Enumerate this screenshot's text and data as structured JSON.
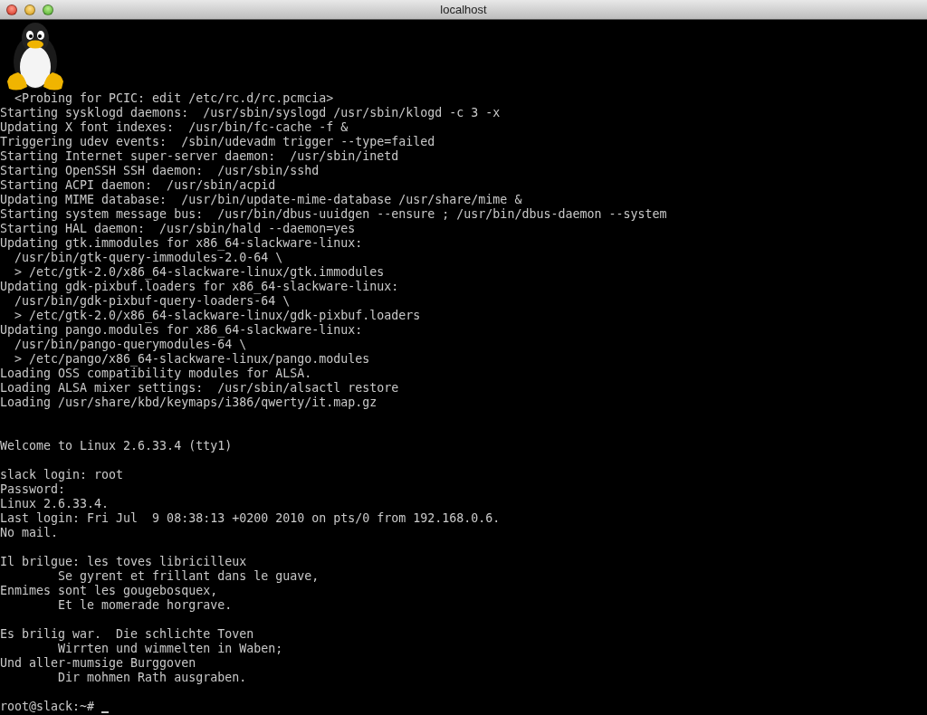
{
  "window": {
    "title": "localhost"
  },
  "terminal": {
    "lines": [
      {
        "kind": "text",
        "text": "  <Probing for PCIC: edit /etc/rc.d/rc.pcmcia>"
      },
      {
        "kind": "text",
        "text": "Starting sysklogd daemons:  /usr/sbin/syslogd /usr/sbin/klogd -c 3 -x"
      },
      {
        "kind": "text",
        "text": "Updating X font indexes:  /usr/bin/fc-cache -f &"
      },
      {
        "kind": "text",
        "text": "Triggering udev events:  /sbin/udevadm trigger --type=failed"
      },
      {
        "kind": "text",
        "text": "Starting Internet super-server daemon:  /usr/sbin/inetd"
      },
      {
        "kind": "text",
        "text": "Starting OpenSSH SSH daemon:  /usr/sbin/sshd"
      },
      {
        "kind": "text",
        "text": "Starting ACPI daemon:  /usr/sbin/acpid"
      },
      {
        "kind": "text",
        "text": "Updating MIME database:  /usr/bin/update-mime-database /usr/share/mime &"
      },
      {
        "kind": "text",
        "text": "Starting system message bus:  /usr/bin/dbus-uuidgen --ensure ; /usr/bin/dbus-daemon --system"
      },
      {
        "kind": "text",
        "text": "Starting HAL daemon:  /usr/sbin/hald --daemon=yes"
      },
      {
        "kind": "text",
        "text": "Updating gtk.immodules for x86_64-slackware-linux:"
      },
      {
        "kind": "text",
        "text": "  /usr/bin/gtk-query-immodules-2.0-64 \\"
      },
      {
        "kind": "text",
        "text": "  > /etc/gtk-2.0/x86_64-slackware-linux/gtk.immodules"
      },
      {
        "kind": "text",
        "text": "Updating gdk-pixbuf.loaders for x86_64-slackware-linux:"
      },
      {
        "kind": "text",
        "text": "  /usr/bin/gdk-pixbuf-query-loaders-64 \\"
      },
      {
        "kind": "text",
        "text": "  > /etc/gtk-2.0/x86_64-slackware-linux/gdk-pixbuf.loaders"
      },
      {
        "kind": "text",
        "text": "Updating pango.modules for x86_64-slackware-linux:"
      },
      {
        "kind": "text",
        "text": "  /usr/bin/pango-querymodules-64 \\"
      },
      {
        "kind": "text",
        "text": "  > /etc/pango/x86_64-slackware-linux/pango.modules"
      },
      {
        "kind": "text",
        "text": "Loading OSS compatibility modules for ALSA."
      },
      {
        "kind": "text",
        "text": "Loading ALSA mixer settings:  /usr/sbin/alsactl restore"
      },
      {
        "kind": "text",
        "text": "Loading /usr/share/kbd/keymaps/i386/qwerty/it.map.gz"
      },
      {
        "kind": "blank"
      },
      {
        "kind": "blank"
      },
      {
        "kind": "text",
        "text": "Welcome to Linux 2.6.33.4 (tty1)"
      },
      {
        "kind": "blank"
      },
      {
        "kind": "text",
        "text": "slack login: root"
      },
      {
        "kind": "text",
        "text": "Password:"
      },
      {
        "kind": "text",
        "text": "Linux 2.6.33.4."
      },
      {
        "kind": "text",
        "text": "Last login: Fri Jul  9 08:38:13 +0200 2010 on pts/0 from 192.168.0.6."
      },
      {
        "kind": "text",
        "text": "No mail."
      },
      {
        "kind": "blank"
      },
      {
        "kind": "text",
        "text": "Il brilgue: les toves libricilleux"
      },
      {
        "kind": "text",
        "text": "        Se gyrent et frillant dans le guave,"
      },
      {
        "kind": "text",
        "text": "Enmimes sont les gougebosquex,"
      },
      {
        "kind": "text",
        "text": "        Et le momerade horgrave."
      },
      {
        "kind": "blank"
      },
      {
        "kind": "text",
        "text": "Es brilig war.  Die schlichte Toven"
      },
      {
        "kind": "text",
        "text": "        Wirrten und wimmelten in Waben;"
      },
      {
        "kind": "text",
        "text": "Und aller-mumsige Burggoven"
      },
      {
        "kind": "text",
        "text": "        Dir mohmen Rath ausgraben."
      },
      {
        "kind": "blank"
      },
      {
        "kind": "prompt",
        "text": "root@slack:~# "
      }
    ]
  }
}
